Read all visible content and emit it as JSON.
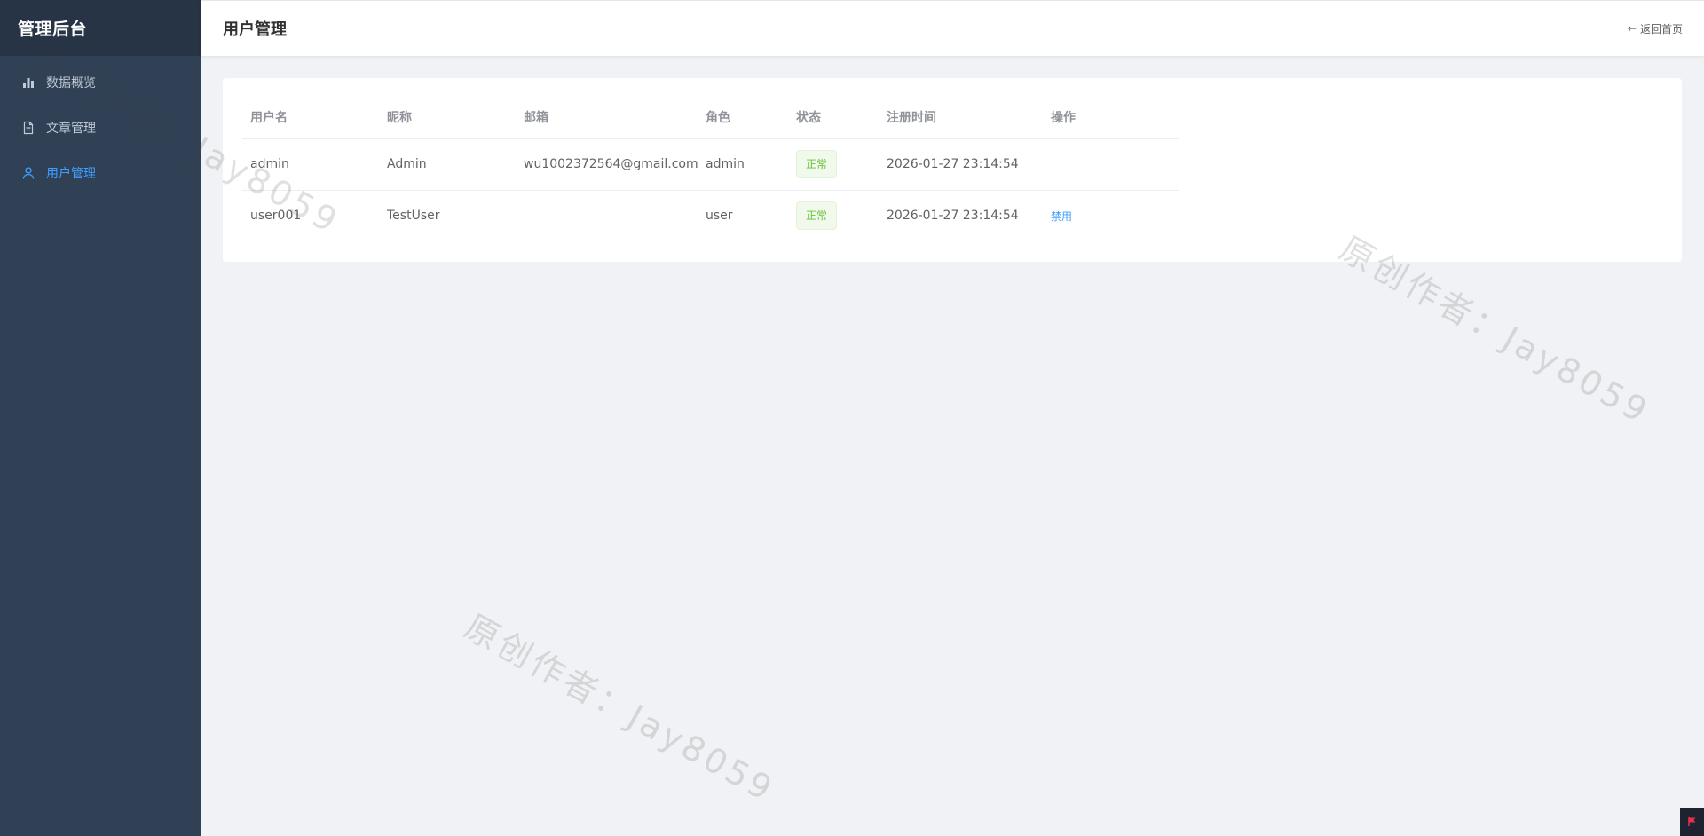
{
  "sidebar": {
    "brand": "管理后台",
    "items": [
      {
        "label": "数据概览",
        "icon": "bar-chart-icon",
        "active": false
      },
      {
        "label": "文章管理",
        "icon": "document-icon",
        "active": false
      },
      {
        "label": "用户管理",
        "icon": "user-icon",
        "active": true
      }
    ]
  },
  "header": {
    "title": "用户管理",
    "back_label": "返回首页",
    "back_icon": "arrow-left-icon"
  },
  "table": {
    "columns": [
      "用户名",
      "昵称",
      "邮箱",
      "角色",
      "状态",
      "注册时间",
      "操作"
    ],
    "rows": [
      {
        "username": "admin",
        "nickname": "Admin",
        "email": "wu1002372564@gmail.com",
        "role": "admin",
        "status": "正常",
        "registered": "2026-01-27 23:14:54",
        "action": ""
      },
      {
        "username": "user001",
        "nickname": "TestUser",
        "email": "",
        "role": "user",
        "status": "正常",
        "registered": "2026-01-27 23:14:54",
        "action": "禁用"
      }
    ]
  },
  "watermark": {
    "text": "原创作者：Jay8059"
  },
  "colors": {
    "sidebar_bg": "#304156",
    "brand_bg": "#263445",
    "accent": "#409eff",
    "success": "#67c23a",
    "page_bg": "#f0f2f5"
  }
}
